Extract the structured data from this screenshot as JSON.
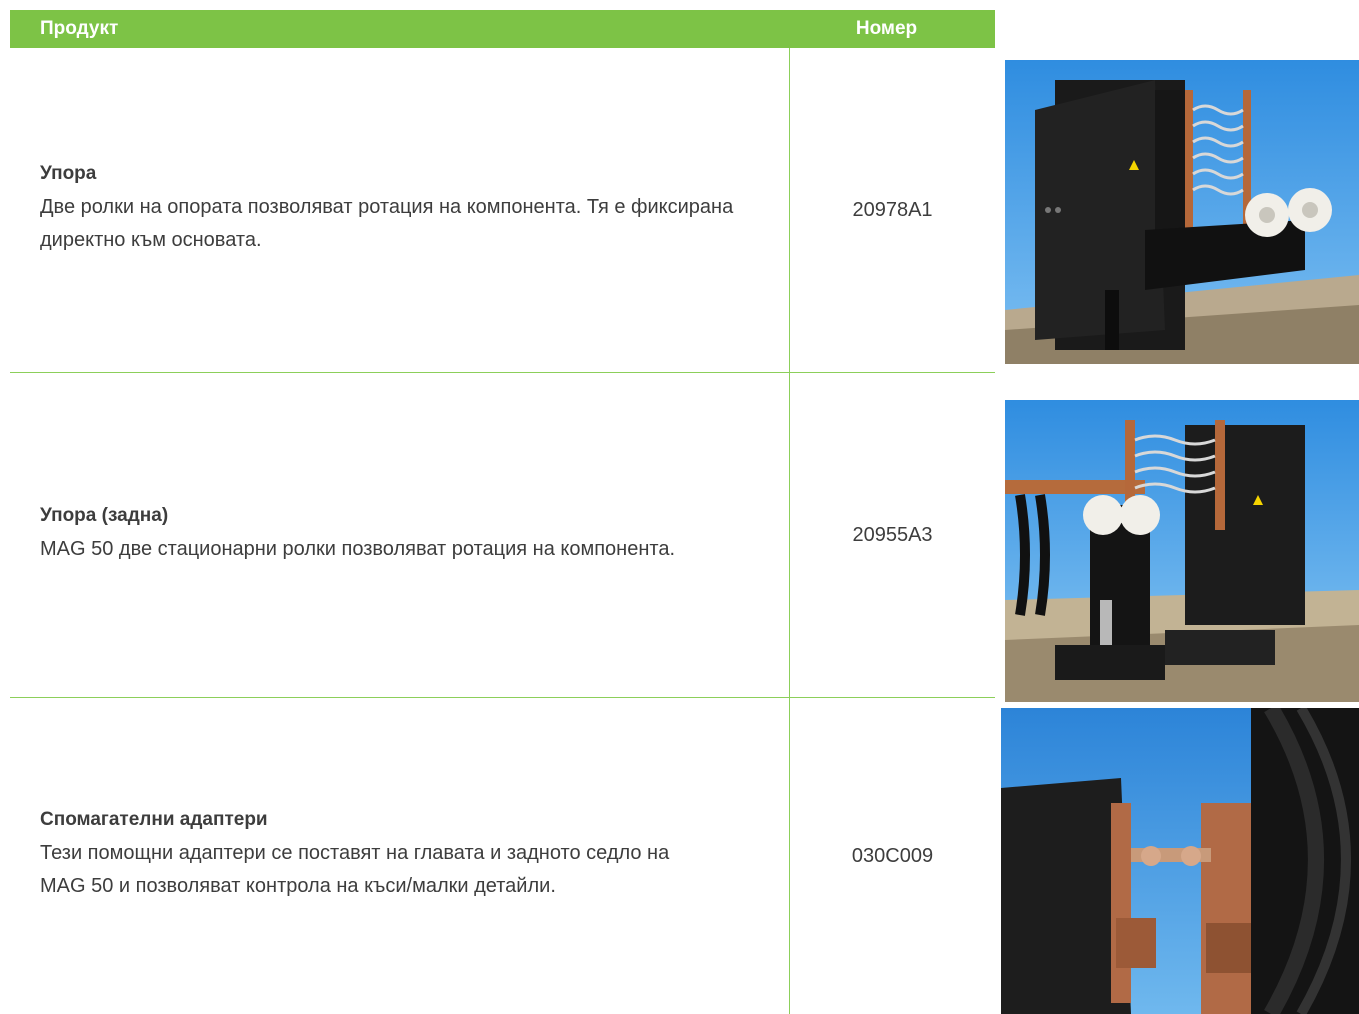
{
  "table": {
    "headers": {
      "product": "Продукт",
      "number": "Номер"
    },
    "rows": [
      {
        "name": "Упора",
        "description": "Две ролки на опората позволяват ротация на компонента. Тя е фиксирана директно към основата.",
        "number": "20978A1",
        "image_icon": "rest-support-photo"
      },
      {
        "name": "Упора (задна)",
        "description": "MAG 50 две стационарни ролки позволяват ротация на компонента.",
        "number": "20955A3",
        "image_icon": "rear-rest-support-photo"
      },
      {
        "name": "Спомагателни адаптери",
        "description": "Тези помощни адаптери се поставят на главата и задното седло на MAG 50 и позволяват контрола на къси/малки детайли.",
        "number": "030C009",
        "image_icon": "auxiliary-adapters-photo"
      }
    ]
  },
  "colors": {
    "header_bg": "#7dc346",
    "header_text": "#ffffff",
    "border": "#8ccf5a",
    "text": "#3d3d3d"
  }
}
